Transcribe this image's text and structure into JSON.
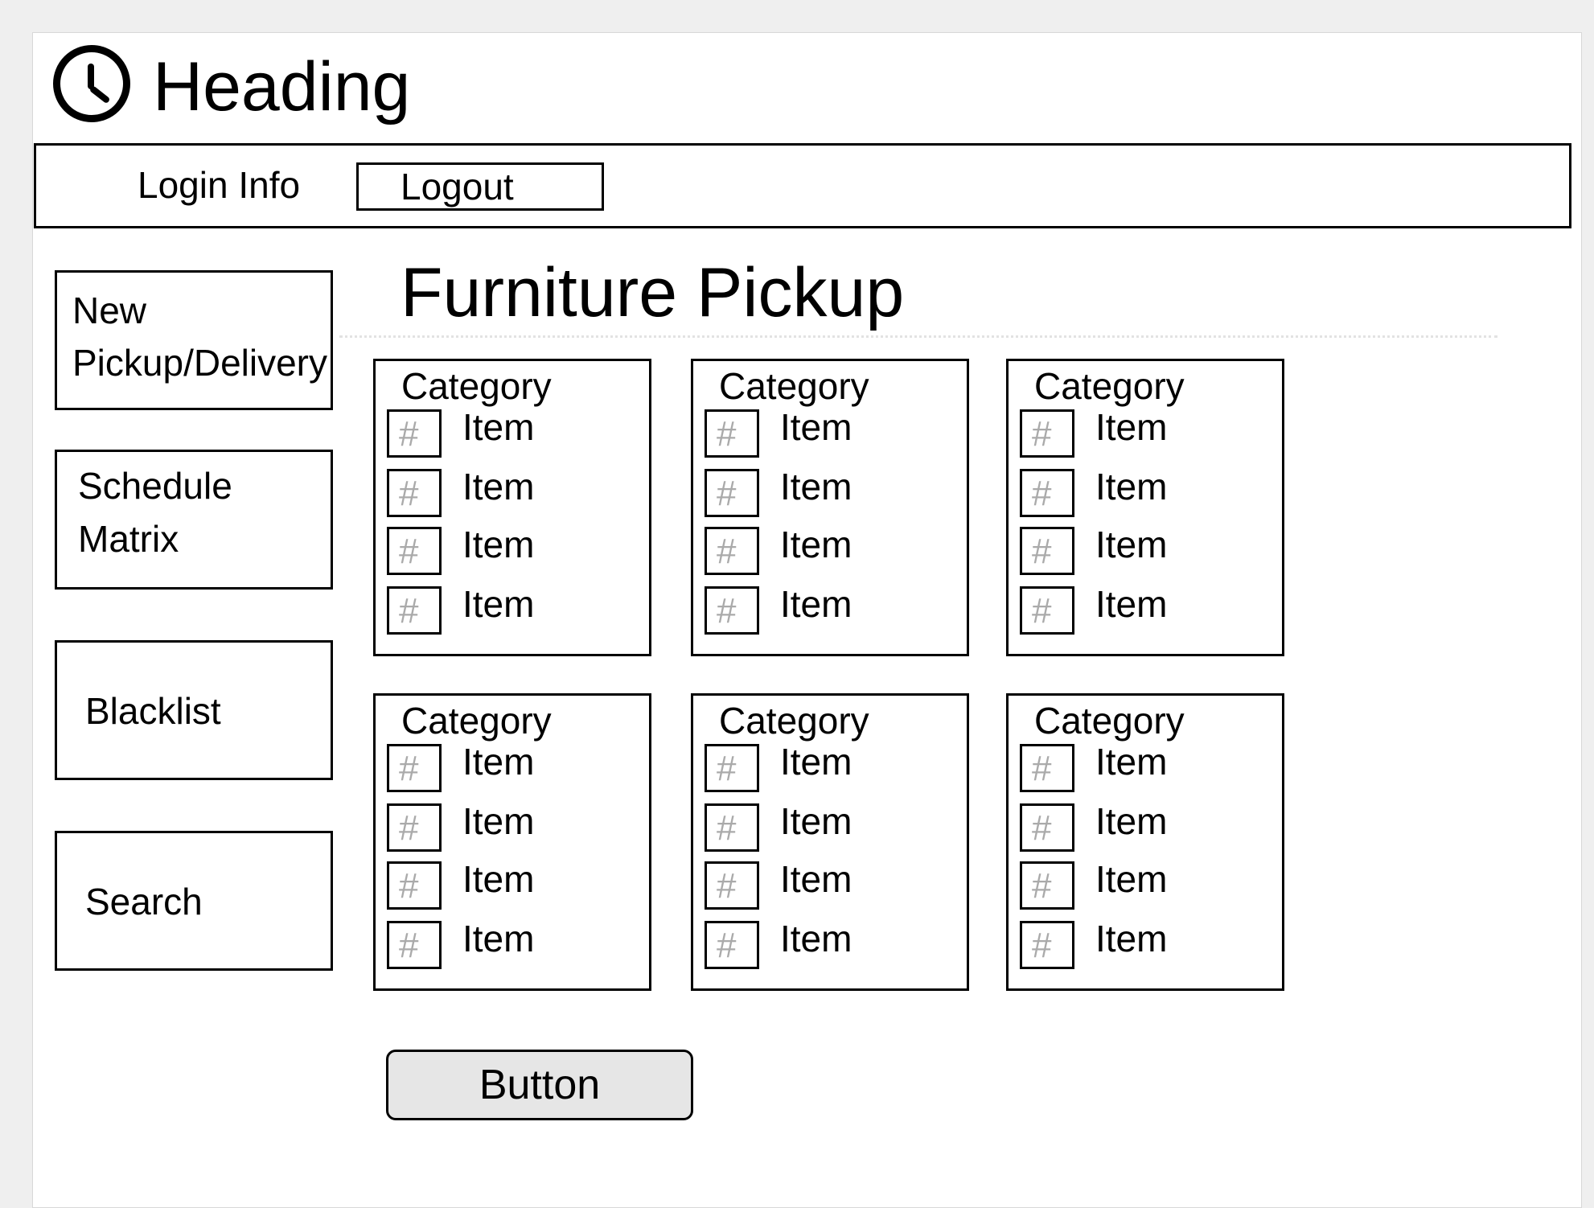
{
  "header": {
    "logo_icon": "clock-icon",
    "heading": "Heading"
  },
  "topbar": {
    "login_info": "Login Info",
    "logout_label": "Logout"
  },
  "sidebar": {
    "items": [
      {
        "lines": [
          "New",
          "Pickup/Delivery"
        ]
      },
      {
        "lines": [
          "Schedule",
          "Matrix"
        ]
      },
      {
        "lines": [
          "Blacklist"
        ]
      },
      {
        "lines": [
          "Search"
        ]
      }
    ]
  },
  "main": {
    "title": "Furniture Pickup",
    "categories": [
      {
        "label": "Category",
        "items": [
          {
            "qty": "#",
            "label": "Item"
          },
          {
            "qty": "#",
            "label": "Item"
          },
          {
            "qty": "#",
            "label": "Item"
          },
          {
            "qty": "#",
            "label": "Item"
          }
        ]
      },
      {
        "label": "Category",
        "items": [
          {
            "qty": "#",
            "label": "Item"
          },
          {
            "qty": "#",
            "label": "Item"
          },
          {
            "qty": "#",
            "label": "Item"
          },
          {
            "qty": "#",
            "label": "Item"
          }
        ]
      },
      {
        "label": "Category",
        "items": [
          {
            "qty": "#",
            "label": "Item"
          },
          {
            "qty": "#",
            "label": "Item"
          },
          {
            "qty": "#",
            "label": "Item"
          },
          {
            "qty": "#",
            "label": "Item"
          }
        ]
      },
      {
        "label": "Category",
        "items": [
          {
            "qty": "#",
            "label": "Item"
          },
          {
            "qty": "#",
            "label": "Item"
          },
          {
            "qty": "#",
            "label": "Item"
          },
          {
            "qty": "#",
            "label": "Item"
          }
        ]
      },
      {
        "label": "Category",
        "items": [
          {
            "qty": "#",
            "label": "Item"
          },
          {
            "qty": "#",
            "label": "Item"
          },
          {
            "qty": "#",
            "label": "Item"
          },
          {
            "qty": "#",
            "label": "Item"
          }
        ]
      },
      {
        "label": "Category",
        "items": [
          {
            "qty": "#",
            "label": "Item"
          },
          {
            "qty": "#",
            "label": "Item"
          },
          {
            "qty": "#",
            "label": "Item"
          },
          {
            "qty": "#",
            "label": "Item"
          }
        ]
      }
    ],
    "button_label": "Button"
  }
}
